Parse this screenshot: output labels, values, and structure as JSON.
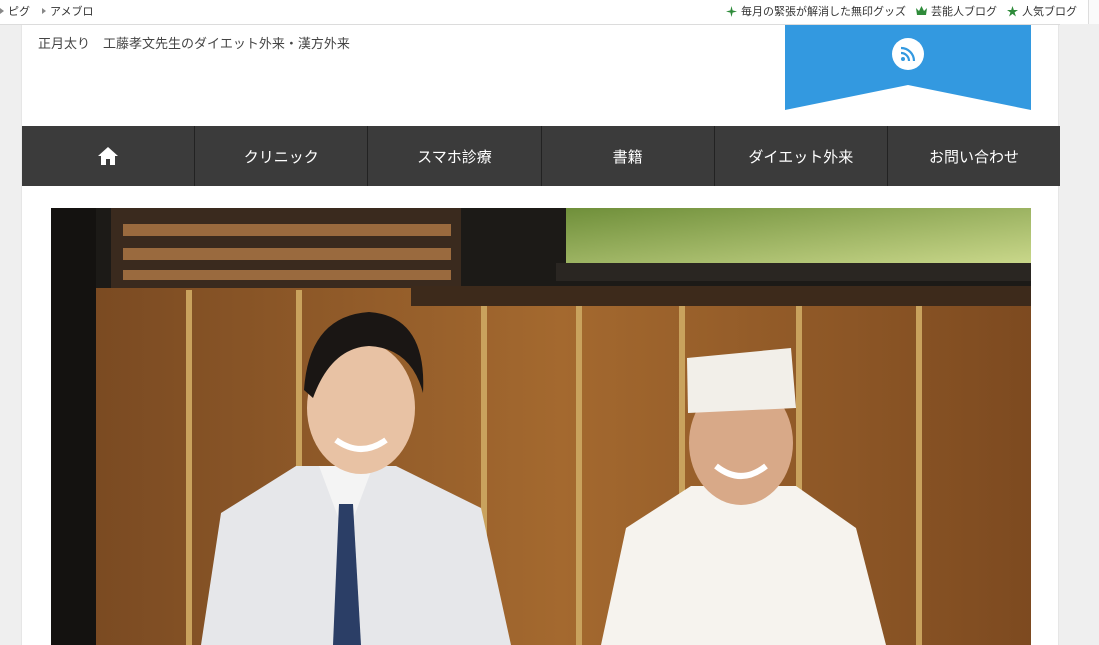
{
  "topbar": {
    "left_links": [
      {
        "label": "ピグ"
      },
      {
        "label": "アメブロ"
      }
    ],
    "right_links": [
      {
        "label": "毎月の緊張が解消した無印グッズ",
        "icon": "sparkle-icon",
        "color": "#2e8b3a"
      },
      {
        "label": "芸能人ブログ",
        "icon": "crown-icon",
        "color": "#2e8b3a"
      },
      {
        "label": "人気ブログ",
        "icon": "star-icon",
        "color": "#2e8b3a"
      }
    ]
  },
  "header": {
    "subtitle": "正月太り　工藤孝文先生のダイエット外来・漢方外来",
    "ribbon_color": "#3399e0",
    "rss_icon": "rss-icon"
  },
  "nav": {
    "background": "#3b3b3b",
    "items": [
      {
        "label": "",
        "icon": "home-icon"
      },
      {
        "label": "クリニック"
      },
      {
        "label": "スマホ診療"
      },
      {
        "label": "書籍"
      },
      {
        "label": "ダイエット外来"
      },
      {
        "label": "お問い合わせ"
      }
    ]
  },
  "hero": {
    "description": "photo"
  }
}
